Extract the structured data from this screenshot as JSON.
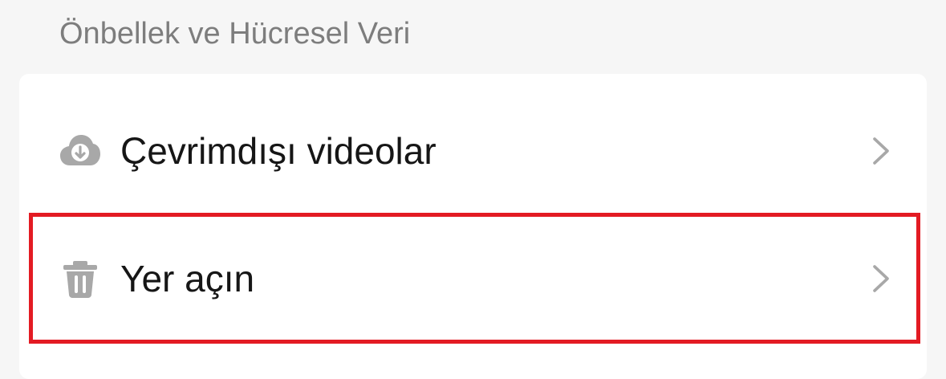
{
  "section": {
    "title": "Önbellek ve Hücresel Veri"
  },
  "rows": [
    {
      "label": "Çevrimdışı videolar",
      "icon": "cloud-download-icon",
      "chevron": "chevron-right-icon"
    },
    {
      "label": "Yer açın",
      "icon": "trash-icon",
      "chevron": "chevron-right-icon"
    }
  ],
  "colors": {
    "background": "#f6f6f6",
    "card": "#ffffff",
    "header_text": "#7d7d7d",
    "row_text": "#161616",
    "icon_gray": "#a8a8a8",
    "chevron_gray": "#a8a8a8",
    "highlight": "#e31b23"
  }
}
